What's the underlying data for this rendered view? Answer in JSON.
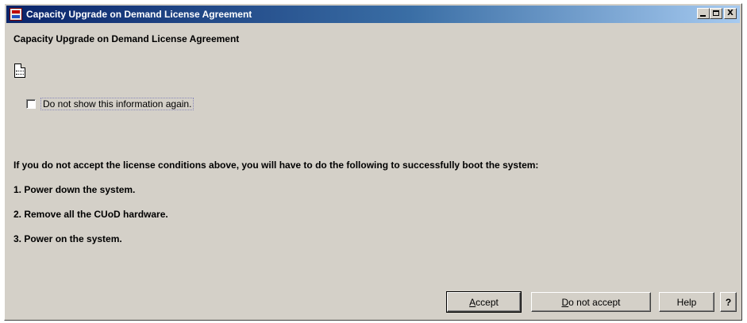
{
  "window": {
    "title": "Capacity Upgrade on Demand License Agreement",
    "controls": {
      "minimize": "_",
      "maximize": "□",
      "close": "X"
    }
  },
  "content": {
    "heading": "Capacity Upgrade on Demand License Agreement",
    "document_icon": "document-icon",
    "checkbox": {
      "label": "Do not show this information again.",
      "checked": false
    },
    "instructions": "If you do not accept the license conditions above, you will have to do the following to successfully boot the system:",
    "steps": [
      "1. Power down the system.",
      "2. Remove all the CUoD hardware.",
      "3. Power on the system."
    ]
  },
  "buttons": {
    "accept": {
      "mnemonic": "A",
      "rest": "ccept"
    },
    "do_not_accept": {
      "mnemonic": "D",
      "rest": "o not accept"
    },
    "help": "Help",
    "question": "?"
  },
  "colors": {
    "titlebar_start": "#0a246a",
    "titlebar_end": "#a6caf0",
    "face": "#d4d0c8"
  }
}
